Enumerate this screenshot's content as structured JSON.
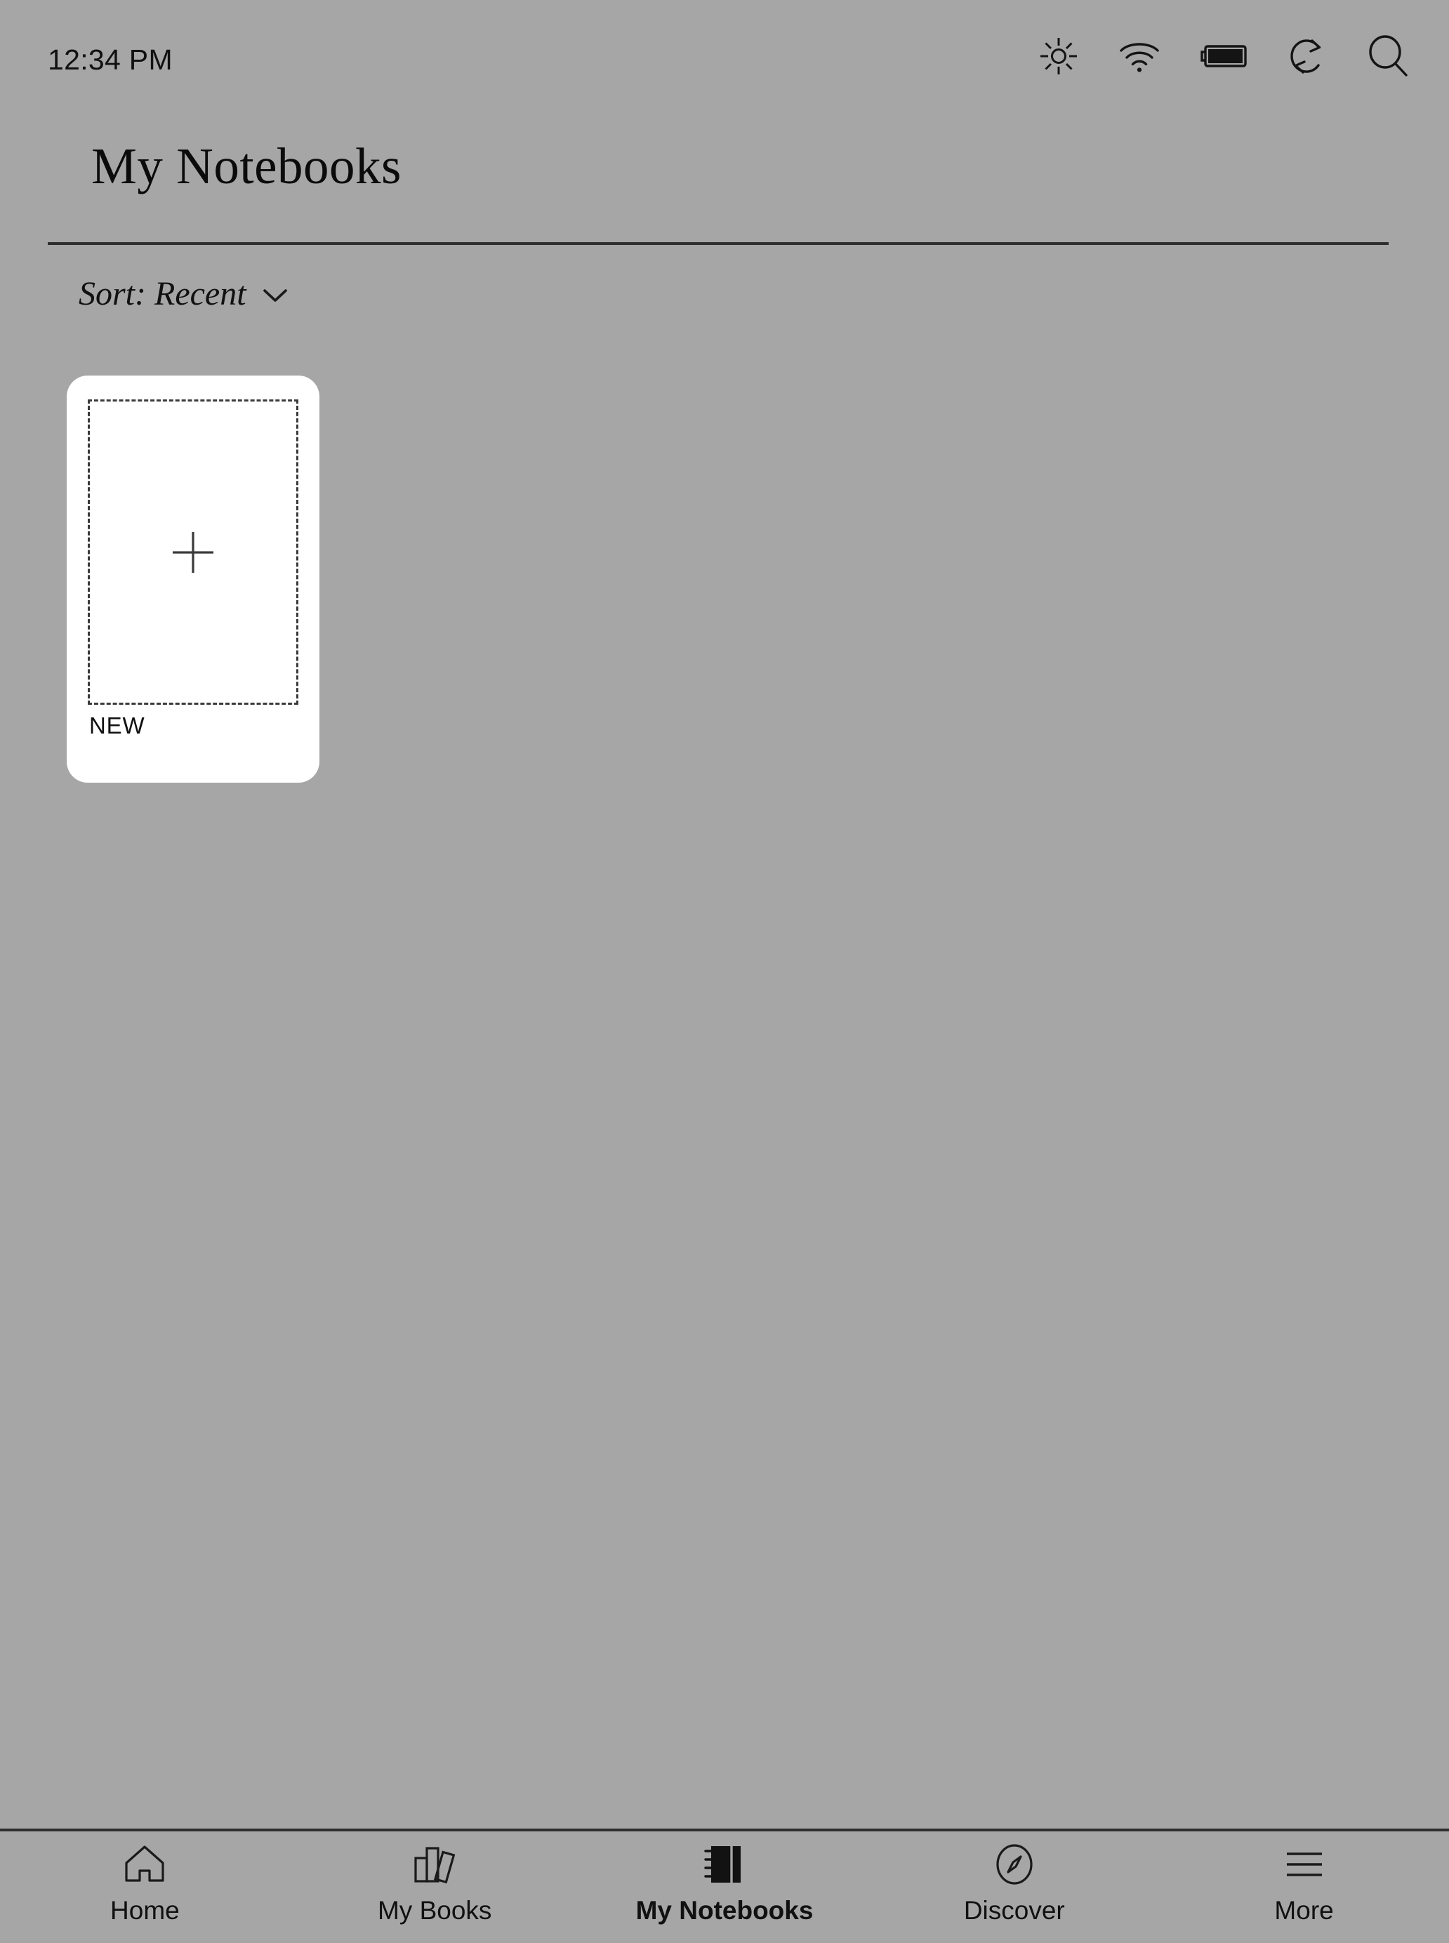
{
  "status_bar": {
    "time": "12:34 PM",
    "icons": [
      {
        "name": "brightness-icon",
        "label": "Brightness"
      },
      {
        "name": "wifi-icon",
        "label": "Wi-Fi"
      },
      {
        "name": "battery-icon",
        "label": "Battery"
      },
      {
        "name": "sync-icon",
        "label": "Sync"
      },
      {
        "name": "search-icon",
        "label": "Search"
      }
    ]
  },
  "header": {
    "title": "My Notebooks"
  },
  "sort": {
    "label": "Sort: Recent",
    "chevron_icon": "chevron-down-icon"
  },
  "notebooks": [
    {
      "label": "NEW",
      "icon": "plus-icon",
      "is_new_card": true
    }
  ],
  "bottom_nav": {
    "active": "My Notebooks",
    "items": [
      {
        "label": "Home",
        "icon": "home-icon",
        "active": false
      },
      {
        "label": "My Books",
        "icon": "books-icon",
        "active": false
      },
      {
        "label": "My Notebooks",
        "icon": "notebook-icon",
        "active": true
      },
      {
        "label": "Discover",
        "icon": "compass-icon",
        "active": false
      },
      {
        "label": "More",
        "icon": "hamburger-icon",
        "active": false
      }
    ]
  },
  "colors": {
    "background": "#a6a6a6",
    "card": "#ffffff",
    "ink": "#111111",
    "rule": "#2e2e2e"
  }
}
